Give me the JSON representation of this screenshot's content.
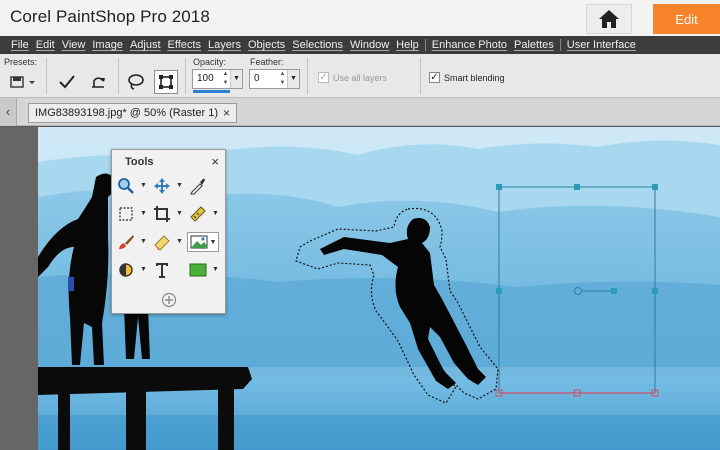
{
  "app": {
    "title": "Corel PaintShop Pro 2018",
    "home_icon": "home-icon",
    "edit_label": "Edit",
    "accent": "#f7842a"
  },
  "menu": [
    "File",
    "Edit",
    "View",
    "Image",
    "Adjust",
    "Effects",
    "Layers",
    "Objects",
    "Selections",
    "Window",
    "Help",
    "Enhance Photo",
    "Palettes",
    "User Interface"
  ],
  "tool_options": {
    "presets_label": "Presets:",
    "opacity_label": "Opacity:",
    "opacity_value": "100",
    "feather_label": "Feather:",
    "feather_value": "0",
    "use_all_layers_label": "Use all layers",
    "use_all_layers_checked": true,
    "use_all_layers_enabled": false,
    "smart_blending_label": "Smart blending",
    "smart_blending_checked": true
  },
  "document_tab": {
    "title": "IMG83893198.jpg* @  50% (Raster 1)",
    "close": "×"
  },
  "tools_palette": {
    "title": "Tools",
    "close": "×",
    "icons": [
      "zoom-icon",
      "pan-icon",
      "dropper-icon",
      "selection-icon",
      "crop-icon",
      "straighten-icon",
      "paint-brush-icon",
      "eraser-icon",
      "picture-tube-icon",
      "dodge-icon",
      "text-icon",
      "rectangle-shape-icon",
      "add-tool-icon"
    ]
  }
}
